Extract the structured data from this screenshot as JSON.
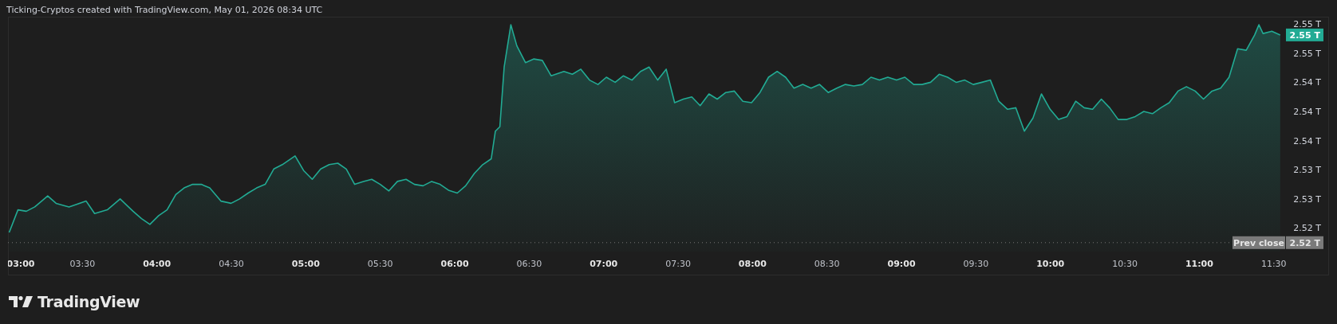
{
  "header": {
    "caption": "Ticking-Cryptos created with TradingView.com, May 01, 2026 08:34 UTC"
  },
  "chart": {
    "chart_data": {
      "type": "area",
      "x": [
        3.008,
        3.067,
        3.123,
        3.18,
        3.267,
        3.323,
        3.41,
        3.525,
        3.582,
        3.667,
        3.753,
        3.84,
        3.897,
        3.953,
        4.012,
        4.068,
        4.127,
        4.183,
        4.24,
        4.298,
        4.355,
        4.43,
        4.498,
        4.555,
        4.613,
        4.67,
        4.727,
        4.785,
        4.842,
        4.928,
        4.985,
        5.043,
        5.1,
        5.157,
        5.215,
        5.272,
        5.328,
        5.387,
        5.443,
        5.5,
        5.558,
        5.615,
        5.673,
        5.73,
        5.787,
        5.845,
        5.902,
        5.958,
        6.017,
        6.073,
        6.132,
        6.188,
        6.245,
        6.273,
        6.303,
        6.332,
        6.377,
        6.417,
        6.475,
        6.532,
        6.588,
        6.647,
        6.733,
        6.79,
        6.847,
        6.905,
        6.962,
        7.018,
        7.077,
        7.133,
        7.19,
        7.248,
        7.305,
        7.363,
        7.42,
        7.477,
        7.535,
        7.592,
        7.648,
        7.707,
        7.763,
        7.82,
        7.878,
        7.935,
        7.993,
        8.05,
        8.107,
        8.165,
        8.222,
        8.278,
        8.337,
        8.393,
        8.45,
        8.508,
        8.565,
        8.623,
        8.68,
        8.737,
        8.795,
        8.852,
        8.908,
        8.967,
        9.023,
        9.082,
        9.138,
        9.195,
        9.253,
        9.31,
        9.367,
        9.425,
        9.482,
        9.54,
        9.597,
        9.653,
        9.712,
        9.768,
        9.825,
        9.883,
        9.94,
        9.998,
        10.055,
        10.112,
        10.17,
        10.227,
        10.283,
        10.342,
        10.398,
        10.455,
        10.513,
        10.57,
        10.627,
        10.685,
        10.742,
        10.798,
        10.857,
        10.913,
        10.972,
        11.028,
        11.085,
        11.143,
        11.2,
        11.257,
        11.315,
        11.372,
        11.4,
        11.428,
        11.487,
        11.543
      ],
      "series": [
        {
          "color": "#22ab94",
          "values": [
            2.5234,
            2.5265,
            2.5263,
            2.5269,
            2.5284,
            2.5274,
            2.5269,
            2.5277,
            2.526,
            2.5265,
            2.528,
            2.5263,
            2.5253,
            2.5245,
            2.5257,
            2.5265,
            2.5286,
            2.5295,
            2.53,
            2.53,
            2.5295,
            2.5277,
            2.5274,
            2.528,
            2.5288,
            2.5295,
            2.53,
            2.5321,
            2.5327,
            2.5339,
            2.5319,
            2.5307,
            2.5321,
            2.5327,
            2.5329,
            2.5321,
            2.53,
            2.5304,
            2.5307,
            2.53,
            2.5291,
            2.5304,
            2.5307,
            2.53,
            2.5298,
            2.5304,
            2.53,
            2.5292,
            2.5288,
            2.5298,
            2.5315,
            2.5327,
            2.5335,
            2.5373,
            2.5379,
            2.5461,
            2.5519,
            2.549,
            2.5467,
            2.5472,
            2.547,
            2.5449,
            2.5455,
            2.5451,
            2.5458,
            2.5443,
            2.5437,
            2.5447,
            2.544,
            2.5449,
            2.5443,
            2.5455,
            2.5461,
            2.5443,
            2.5458,
            2.5412,
            2.5417,
            2.542,
            2.5408,
            2.5424,
            2.5417,
            2.5426,
            2.5428,
            2.5414,
            2.5412,
            2.5426,
            2.5447,
            2.5455,
            2.5447,
            2.5432,
            2.5437,
            2.5432,
            2.5437,
            2.5426,
            2.5432,
            2.5437,
            2.5435,
            2.5437,
            2.5447,
            2.5443,
            2.5447,
            2.5443,
            2.5447,
            2.5437,
            2.5437,
            2.544,
            2.5451,
            2.5447,
            2.544,
            2.5443,
            2.5437,
            2.544,
            2.5443,
            2.5414,
            2.5403,
            2.5405,
            2.5373,
            2.5391,
            2.5424,
            2.5403,
            2.5389,
            2.5393,
            2.5414,
            2.5405,
            2.5403,
            2.5417,
            2.5405,
            2.5389,
            2.5389,
            2.5393,
            2.54,
            2.5397,
            2.5405,
            2.5412,
            2.5428,
            2.5434,
            2.5428,
            2.5417,
            2.5428,
            2.5432,
            2.5447,
            2.5486,
            2.5484,
            2.5505,
            2.5519,
            2.5507,
            2.551,
            2.5505
          ]
        }
      ],
      "xlim": [
        3,
        11.871
      ],
      "ylim": [
        2.5175,
        2.553
      ],
      "xticks": [
        {
          "value": 3,
          "label": "03:00"
        },
        {
          "value": 3.5,
          "label": "03:30"
        },
        {
          "value": 4,
          "label": "04:00"
        },
        {
          "value": 4.5,
          "label": "04:30"
        },
        {
          "value": 5,
          "label": "05:00"
        },
        {
          "value": 5.5,
          "label": "05:30"
        },
        {
          "value": 6,
          "label": "06:00"
        },
        {
          "value": 6.5,
          "label": "06:30"
        },
        {
          "value": 7,
          "label": "07:00"
        },
        {
          "value": 7.5,
          "label": "07:30"
        },
        {
          "value": 8,
          "label": "08:00"
        },
        {
          "value": 8.5,
          "label": "08:30"
        },
        {
          "value": 9,
          "label": "09:00"
        },
        {
          "value": 9.5,
          "label": "09:30"
        },
        {
          "value": 10,
          "label": "10:00"
        },
        {
          "value": 10.5,
          "label": "10:30"
        },
        {
          "value": 11,
          "label": "11:00"
        },
        {
          "value": 11.5,
          "label": "11:30"
        }
      ],
      "yticks": [
        {
          "value": 2.552,
          "label": "2.55 T"
        },
        {
          "value": 2.548,
          "label": "2.55 T"
        },
        {
          "value": 2.544,
          "label": "2.54 T"
        },
        {
          "value": 2.54,
          "label": "2.54 T"
        },
        {
          "value": 2.536,
          "label": "2.54 T"
        },
        {
          "value": 2.532,
          "label": "2.53 T"
        },
        {
          "value": 2.528,
          "label": "2.53 T"
        },
        {
          "value": 2.524,
          "label": "2.52 T"
        }
      ],
      "ref_lines": [
        {
          "axis": "y",
          "value": 2.522,
          "label": "Prev close"
        }
      ]
    },
    "last_price_label": "2.55 T",
    "prev_close_value_label": "2.52 T"
  },
  "footer": {
    "logo_text": "TradingView"
  }
}
